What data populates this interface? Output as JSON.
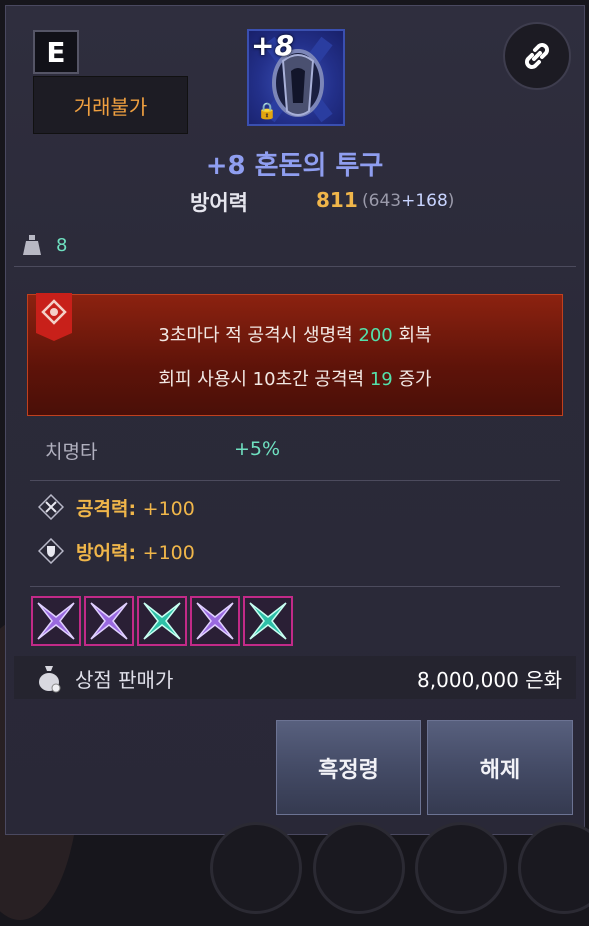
{
  "grade": "E",
  "trade_status": "거래불가",
  "item": {
    "plus_badge": "+8",
    "name": "+8 혼돈의 투구"
  },
  "defense": {
    "label": "방어력",
    "value": "811",
    "open": "(643",
    "bonus": "+168",
    "close": ")"
  },
  "weight": "8",
  "set_effect": {
    "line1_pre": "3초마다 적 공격시 생명력 ",
    "line1_num": "200",
    "line1_post": " 회복",
    "line2_pre": "회피 사용시 10초간 공격력 ",
    "line2_num": "19",
    "line2_post": " 증가"
  },
  "crit": {
    "label": "치명타",
    "value": "+5%"
  },
  "options": [
    {
      "label": "공격력:",
      "value": "+100",
      "icon": "sword-cross-icon"
    },
    {
      "label": "방어력:",
      "value": "+100",
      "icon": "shield-icon"
    }
  ],
  "gems": [
    "purple",
    "purple",
    "teal",
    "purple",
    "teal"
  ],
  "sell": {
    "label": "상점 판매가",
    "value": "8,000,000 은화"
  },
  "buttons": {
    "left": "흑정령",
    "right": "해제"
  },
  "colors": {
    "accent_name": "#8f9ef0",
    "gold": "#f0b64a",
    "green": "#54e0aa",
    "set_red": "#8c2210"
  }
}
